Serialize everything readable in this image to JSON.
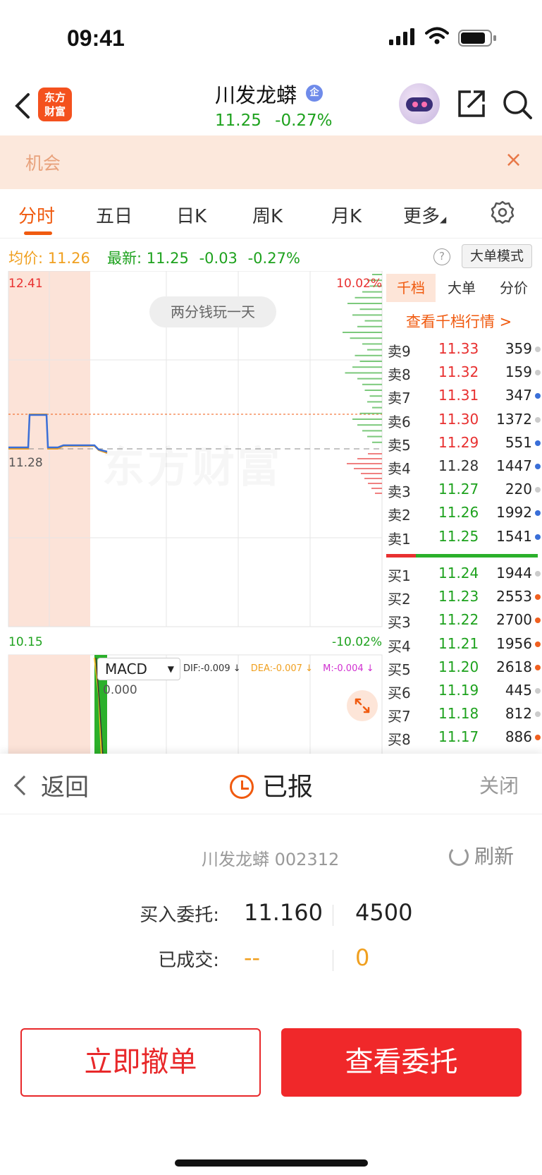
{
  "status_bar": {
    "time": "09:41"
  },
  "header": {
    "logo_line1": "东方",
    "logo_line2": "财富",
    "stock_name": "川发龙蟒",
    "badge": "企",
    "price": "11.25",
    "change_pct": "-0.27%"
  },
  "banner": {
    "text": "机会",
    "close": "×"
  },
  "tabs": [
    {
      "label": "分时"
    },
    {
      "label": "五日"
    },
    {
      "label": "日K"
    },
    {
      "label": "周K"
    },
    {
      "label": "月K"
    },
    {
      "label": "更多"
    }
  ],
  "info": {
    "avg_label": "均价:",
    "avg_value": "11.26",
    "last_label": "最新:",
    "last_value": "11.25",
    "change": "-0.03",
    "change_pct": "-0.27%",
    "help": "?",
    "big_mode": "大单模式"
  },
  "chart": {
    "price_high": "12.41",
    "price_mid": "11.28",
    "price_low": "10.15",
    "pct_high": "10.02%",
    "pct_low": "-10.02%",
    "watermark": "东方财富",
    "pill": "两分钱玩一天",
    "macd_select": "MACD",
    "dif": "DIF:-0.009 ↓",
    "dea": "DEA:-0.007 ↓",
    "m": "M:-0.004 ↓",
    "macd_zero": "0.000",
    "colors": {
      "up": "#e83030",
      "down": "#1ea21e",
      "avg_line": "#f0a020",
      "price_line": "#3a6fd8"
    }
  },
  "order_book": {
    "tabs": [
      "千档",
      "大单",
      "分价"
    ],
    "link": "查看千档行情 >",
    "asks": [
      {
        "label": "卖9",
        "price": "11.33",
        "vol": "359",
        "dot": "#cccccc",
        "color": "#e83030"
      },
      {
        "label": "卖8",
        "price": "11.32",
        "vol": "159",
        "dot": "#cccccc",
        "color": "#e83030"
      },
      {
        "label": "卖7",
        "price": "11.31",
        "vol": "347",
        "dot": "#3a6fd8",
        "color": "#e83030"
      },
      {
        "label": "卖6",
        "price": "11.30",
        "vol": "1372",
        "dot": "#cccccc",
        "color": "#e83030"
      },
      {
        "label": "卖5",
        "price": "11.29",
        "vol": "551",
        "dot": "#3a6fd8",
        "color": "#e83030"
      },
      {
        "label": "卖4",
        "price": "11.28",
        "vol": "1447",
        "dot": "#3a6fd8",
        "color": "#333333"
      },
      {
        "label": "卖3",
        "price": "11.27",
        "vol": "220",
        "dot": "#cccccc",
        "color": "#1ea21e"
      },
      {
        "label": "卖2",
        "price": "11.26",
        "vol": "1992",
        "dot": "#3a6fd8",
        "color": "#1ea21e"
      },
      {
        "label": "卖1",
        "price": "11.25",
        "vol": "1541",
        "dot": "#3a6fd8",
        "color": "#1ea21e"
      }
    ],
    "bids": [
      {
        "label": "买1",
        "price": "11.24",
        "vol": "1944",
        "dot": "#cccccc",
        "color": "#1ea21e"
      },
      {
        "label": "买2",
        "price": "11.23",
        "vol": "2553",
        "dot": "#f06020",
        "color": "#1ea21e"
      },
      {
        "label": "买3",
        "price": "11.22",
        "vol": "2700",
        "dot": "#f06020",
        "color": "#1ea21e"
      },
      {
        "label": "买4",
        "price": "11.21",
        "vol": "1956",
        "dot": "#f06020",
        "color": "#1ea21e"
      },
      {
        "label": "买5",
        "price": "11.20",
        "vol": "2618",
        "dot": "#f06020",
        "color": "#1ea21e"
      },
      {
        "label": "买6",
        "price": "11.19",
        "vol": "445",
        "dot": "#cccccc",
        "color": "#1ea21e"
      },
      {
        "label": "买7",
        "price": "11.18",
        "vol": "812",
        "dot": "#cccccc",
        "color": "#1ea21e"
      },
      {
        "label": "买8",
        "price": "11.17",
        "vol": "886",
        "dot": "#f06020",
        "color": "#1ea21e"
      }
    ]
  },
  "sheet": {
    "back": "返回",
    "status": "已报",
    "close": "关闭",
    "stock": "川发龙蟒 002312",
    "refresh": "刷新",
    "order_label": "买入委托:",
    "order_price": "11.160",
    "order_qty": "4500",
    "filled_label": "已成交:",
    "filled_price": "--",
    "filled_qty": "0",
    "cancel_button": "立即撤单",
    "view_button": "查看委托"
  }
}
